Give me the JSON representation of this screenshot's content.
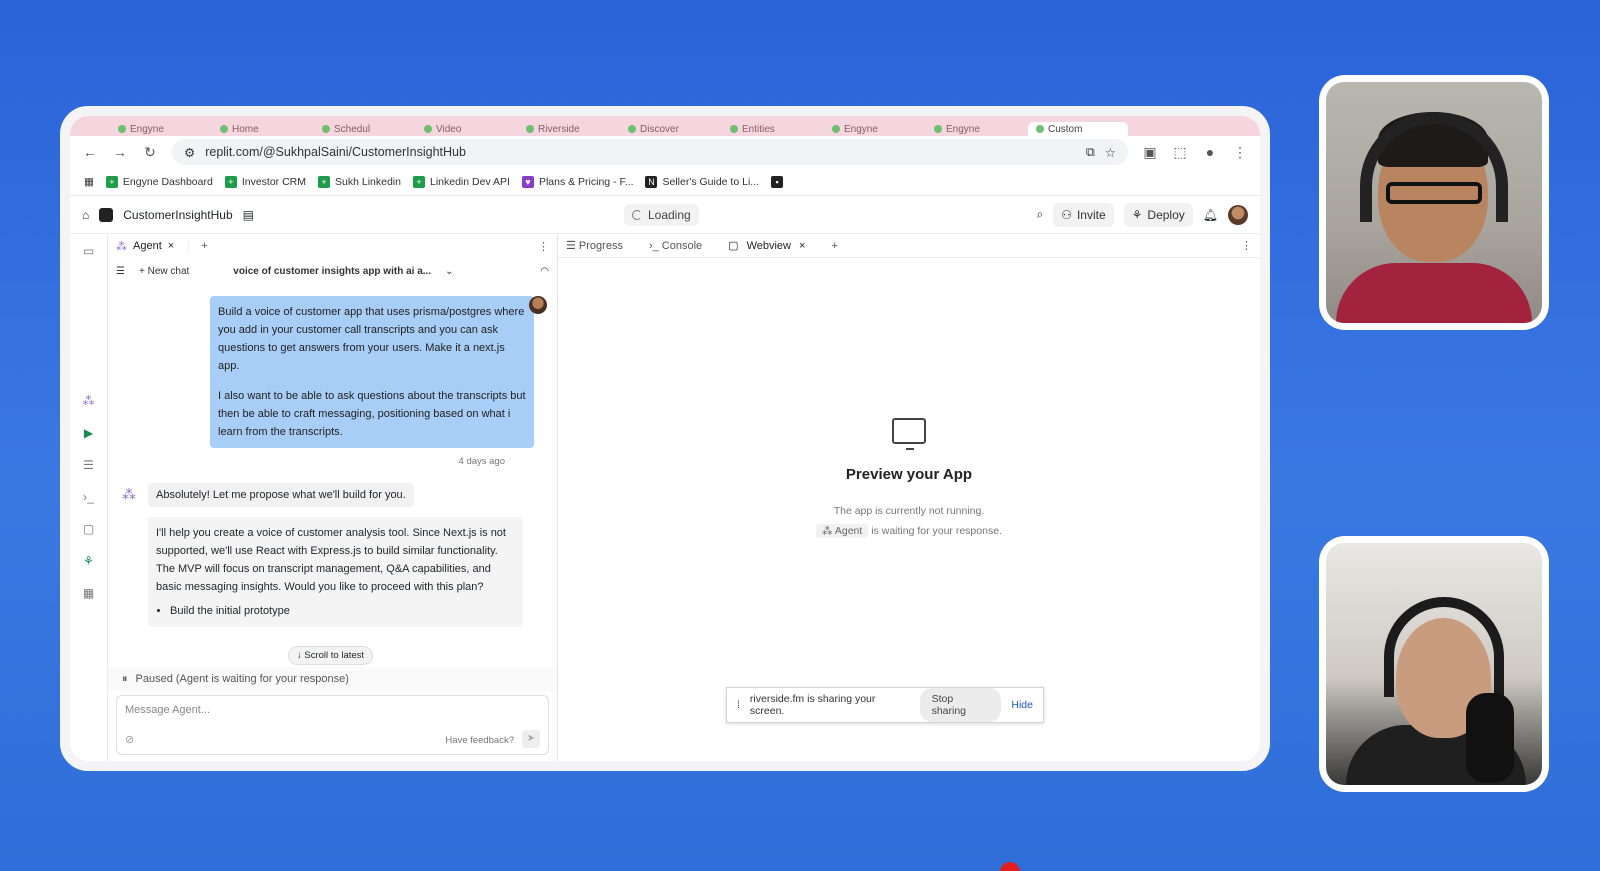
{
  "browser": {
    "tabs": [
      "Engyne",
      "Home",
      "Schedul",
      "Video",
      "Riverside",
      "Discover",
      "Entities",
      "Engyne",
      "Engyne",
      "Custom"
    ],
    "url": "replit.com/@SukhpalSaini/CustomerInsightHub",
    "bookmarks": [
      "Engyne Dashboard",
      "Investor CRM",
      "Sukh Linkedin",
      "Linkedin Dev API",
      "Plans & Pricing - F...",
      "Seller's Guide to Li..."
    ]
  },
  "replit": {
    "project_name": "CustomerInsightHub",
    "loading_label": "Loading",
    "invite_label": "Invite",
    "deploy_label": "Deploy"
  },
  "left_panel": {
    "tab_label": "Agent",
    "new_chat_label": "New chat",
    "chat_title": "voice of customer insights app with ai a...",
    "user_message_p1": "Build a voice of customer app that uses prisma/postgres where you add in your customer call transcripts and you can ask questions to get answers from your users. Make it a next.js app.",
    "user_message_p2": "I also want to be able to ask questions about the transcripts but then be able to craft messaging, positioning based on what i learn from the transcripts.",
    "timestamp": "4 days ago",
    "agent_message_1": "Absolutely! Let me propose what we'll build for you.",
    "agent_message_2": "I'll help you create a voice of customer analysis tool. Since Next.js is not supported, we'll use React with Express.js to build similar functionality. The MVP will focus on transcript management, Q&A capabilities, and basic messaging insights. Would you like to proceed with this plan?",
    "bullet_1": "Build the initial prototype",
    "scroll_latest_label": "Scroll to latest",
    "paused_text": "Paused (Agent is waiting for your response)",
    "input_placeholder": "Message Agent...",
    "feedback_label": "Have feedback?"
  },
  "right_panel": {
    "tabs": [
      "Progress",
      "Console",
      "Webview"
    ],
    "preview_title": "Preview your App",
    "preview_line1": "The app is currently not running.",
    "agent_chip": "Agent",
    "preview_line2": "is waiting for your response."
  },
  "share_bar": {
    "text": "riverside.fm is sharing your screen.",
    "stop_label": "Stop sharing",
    "hide_label": "Hide"
  }
}
